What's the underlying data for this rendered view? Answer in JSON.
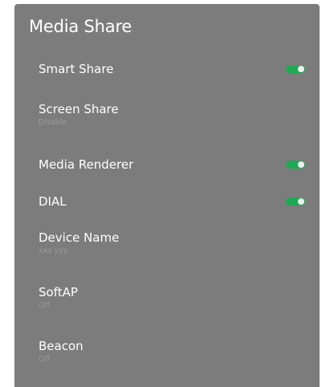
{
  "panel": {
    "title": "Media Share"
  },
  "settings": [
    {
      "label": "Smart Share",
      "toggle": true
    },
    {
      "label": "Screen Share",
      "value": "Disable"
    },
    {
      "label": "Media Renderer",
      "toggle": true
    },
    {
      "label": "DIAL",
      "toggle": true
    },
    {
      "label": "Device Name",
      "value": "xxx yyy"
    },
    {
      "label": "SoftAP",
      "value": "Off"
    },
    {
      "label": "Beacon",
      "value": "Off"
    }
  ],
  "colors": {
    "panel_bg": "#7c7c7c",
    "toggle_on": "#1eaa55",
    "secondary_text": "#9a9a9a"
  }
}
